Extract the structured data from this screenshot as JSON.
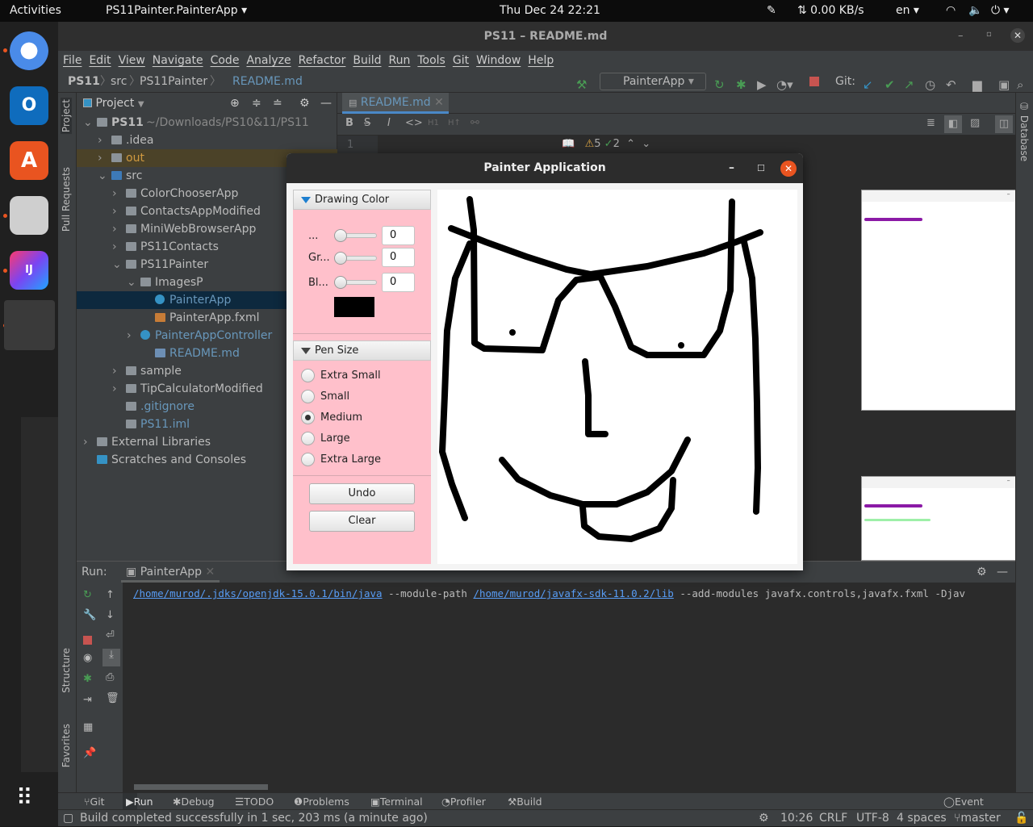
{
  "topbar": {
    "activities": "Activities",
    "app_menu": "PS11Painter.PainterApp ▾",
    "clock": "Thu Dec 24  22:21",
    "net": "⇅ 0.00 KB/s",
    "lang": "en ▾"
  },
  "ide": {
    "title": "PS11 – README.md",
    "menu": [
      "File",
      "Edit",
      "View",
      "Navigate",
      "Code",
      "Analyze",
      "Refactor",
      "Build",
      "Run",
      "Tools",
      "Git",
      "Window",
      "Help"
    ],
    "breadcrumb": [
      "PS11",
      "src",
      "PS11Painter",
      "README.md"
    ],
    "run_config": "PainterApp",
    "git_label": "Git:",
    "project_label": "Project",
    "editor_tab": "README.md",
    "line_number": "1",
    "warnings": "5",
    "typos": "2",
    "tree": [
      {
        "label": "PS11",
        "extra": "~/Downloads/PS10&11/PS11"
      },
      {
        "label": ".idea"
      },
      {
        "label": "out"
      },
      {
        "label": "src"
      },
      {
        "label": "ColorChooserApp"
      },
      {
        "label": "ContactsAppModified"
      },
      {
        "label": "MiniWebBrowserApp"
      },
      {
        "label": "PS11Contacts"
      },
      {
        "label": "PS11Painter"
      },
      {
        "label": "ImagesP"
      },
      {
        "label": "PainterApp"
      },
      {
        "label": "PainterApp.fxml"
      },
      {
        "label": "PainterAppController"
      },
      {
        "label": "README.md"
      },
      {
        "label": "sample"
      },
      {
        "label": "TipCalculatorModified"
      },
      {
        "label": ".gitignore"
      },
      {
        "label": "PS11.iml"
      },
      {
        "label": "External Libraries"
      },
      {
        "label": "Scratches and Consoles"
      }
    ],
    "side_tabs": {
      "project": "Project",
      "pull_requests": "Pull Requests",
      "structure": "Structure",
      "favorites": "Favorites",
      "database": "Database"
    },
    "run": {
      "label": "Run:",
      "tab": "PainterApp",
      "cmd_java": "/home/murod/.jdks/openjdk-15.0.1/bin/java",
      "cmd_mp": " --module-path ",
      "cmd_lib": "/home/murod/javafx-sdk-11.0.2/lib",
      "cmd_rest": " --add-modules javafx.controls,javafx.fxml -Djav"
    },
    "bottom_tabs": [
      "Git",
      "Run",
      "Debug",
      "TODO",
      "Problems",
      "Terminal",
      "Profiler",
      "Build"
    ],
    "event_log": "Event Log",
    "status": {
      "message": "Build completed successfully in 1 sec, 203 ms (a minute ago)",
      "position": "10:26",
      "line_sep": "CRLF",
      "encoding": "UTF-8",
      "indent": "4 spaces",
      "branch": "master"
    }
  },
  "painter": {
    "title": "Painter Application",
    "color_section": "Drawing Color",
    "sliders": [
      {
        "label": "...",
        "value": "0"
      },
      {
        "label": "Gr...",
        "value": "0"
      },
      {
        "label": "Bl...",
        "value": "0"
      }
    ],
    "swatch_color": "#000000",
    "pen_section": "Pen Size",
    "pen_sizes": [
      "Extra Small",
      "Small",
      "Medium",
      "Large",
      "Extra Large"
    ],
    "selected_pen": "Medium",
    "undo": "Undo",
    "clear": "Clear",
    "panel_color": "#ffc0cb"
  }
}
